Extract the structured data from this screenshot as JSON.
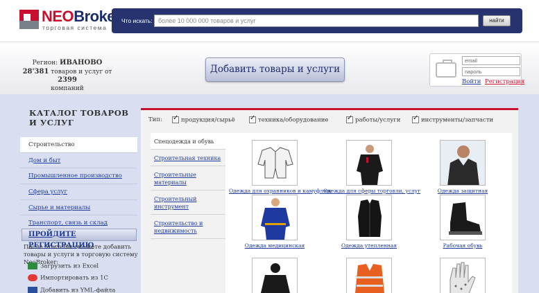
{
  "header": {
    "logo_title_part1": "NEO",
    "logo_title_part2": "Broker",
    "logo_subtitle": "торговая   система",
    "search_label": "Что искать:",
    "search_placeholder": "более 10 000 000 товаров и услуг",
    "search_button": "найти"
  },
  "info": {
    "region_label": "Регион:",
    "region_name": "ИВАНОВО",
    "stats_goods": "28'381",
    "stats_text": "товаров и услуг от",
    "stats_companies": "2399",
    "stats_companies_label": "компаний",
    "add_button": "Добавить товары и услуги",
    "login_email_placeholder": "email",
    "login_password_placeholder": "пароль",
    "login_link": "Войти",
    "register_link": "Регистрация"
  },
  "catalog": {
    "title": "КАТАЛОГ ТОВАРОВ И УСЛУГ",
    "items": [
      {
        "label": "Строительство",
        "active": true
      },
      {
        "label": "Дом и быт",
        "active": false
      },
      {
        "label": "Промышленное производство",
        "active": false
      },
      {
        "label": "Сфера услуг",
        "active": false
      },
      {
        "label": "Сырье и материалы",
        "active": false
      },
      {
        "label": "Транспорт, связь и склад",
        "active": false
      }
    ]
  },
  "registration": {
    "heading": "ПРОЙДИТЕ РЕГИСТРАЦИЮ",
    "text": "После этого Вы сможете добавить товары и услуги в торговую систему NeoBroker:",
    "imports": [
      {
        "label": "Загрузить из Excel",
        "icon": "excel-icon"
      },
      {
        "label": "Импортировать из 1С",
        "icon": "1c-icon"
      },
      {
        "label": "Добавить из YML-файла",
        "icon": "yml-icon"
      }
    ]
  },
  "filters": {
    "type_label": "Тип:",
    "options": [
      {
        "label": "продукция/сырьё",
        "checked": true
      },
      {
        "label": "техника/оборудование",
        "checked": true
      },
      {
        "label": "работы/услуги",
        "checked": true
      },
      {
        "label": "инструменты/запчасти",
        "checked": true
      }
    ]
  },
  "subcategories": [
    {
      "label": "Спецодежда и обувь",
      "active": true
    },
    {
      "label": "Строительная техника",
      "active": false
    },
    {
      "label": "Строительные материалы",
      "active": false
    },
    {
      "label": "Строительный инструмент",
      "active": false
    },
    {
      "label": "Строительство и недвижимость",
      "active": false
    }
  ],
  "products": [
    {
      "caption": "Одежда для охранников и камуфляж",
      "icon": "workwear-suit-icon"
    },
    {
      "caption": "Одежда для сферы торговли, услуг",
      "icon": "worker-black-uniform-icon"
    },
    {
      "caption": "Одежда защитная",
      "icon": "leather-jacket-icon"
    },
    {
      "caption": "Одежда медицинская",
      "icon": "blue-uniform-icon"
    },
    {
      "caption": "Одежда утепленная",
      "icon": "insulated-vest-icon"
    },
    {
      "caption": "Рабочая обувь",
      "icon": "work-boot-icon"
    },
    {
      "caption": "",
      "icon": "worker-icon"
    },
    {
      "caption": "",
      "icon": "life-vest-icon"
    },
    {
      "caption": "",
      "icon": "work-gloves-icon"
    }
  ],
  "colors": {
    "brand_red": "#c8102e",
    "brand_blue": "#26336e",
    "link_blue": "#1e3a9b",
    "main_background": "#d9dff0"
  }
}
